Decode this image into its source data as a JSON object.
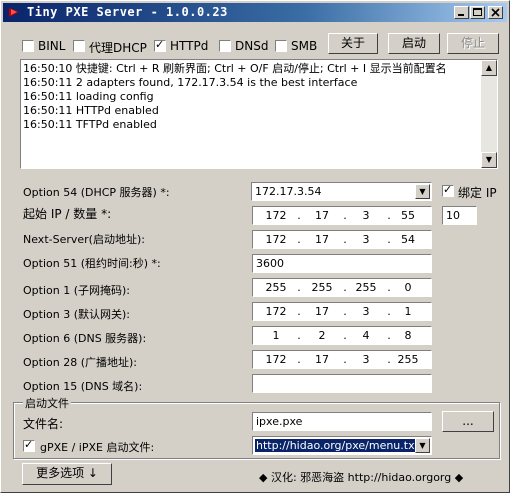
{
  "window": {
    "title": "Tiny PXE Server - 1.0.0.23"
  },
  "services": [
    {
      "label": "BINL",
      "checked": false
    },
    {
      "label": "代理DHCP",
      "checked": false
    },
    {
      "label": "HTTPd",
      "checked": true
    },
    {
      "label": "DNSd",
      "checked": false
    },
    {
      "label": "SMB",
      "checked": false
    }
  ],
  "buttons": {
    "close": "关于",
    "start": "启动",
    "stop": "停止",
    "browse": "...",
    "more_options": "更多选项 ↓"
  },
  "log": [
    "16:50:10 快捷键:  Ctrl + R 刷新界面;  Ctrl + O/F 启动/停止;  Ctrl + I 显示当前配置名",
    "16:50:11 2 adapters found, 172.17.3.54 is the best interface",
    "16:50:11 loading config",
    "16:50:11 HTTPd enabled",
    "16:50:11 TFTPd enabled"
  ],
  "form": {
    "option54_label": "Option 54 (DHCP 服务器) *:",
    "option54_value": "172.17.3.54",
    "bind_ip_label": "绑定 IP",
    "bind_ip_checked": true,
    "start_ip_label": "起始 IP / 数量 *:",
    "start_ip": [
      "172",
      "17",
      "3",
      "55"
    ],
    "count": "10",
    "next_server_label": "Next-Server(启动地址):",
    "next_server": [
      "172",
      "17",
      "3",
      "54"
    ],
    "option51_label": "Option 51 (租约时间:秒) *:",
    "option51_value": "3600",
    "option1_label": "Option 1 (子网掩码):",
    "option1": [
      "255",
      "255",
      "255",
      "0"
    ],
    "option3_label": "Option 3 (默认网关):",
    "option3": [
      "172",
      "17",
      "3",
      "1"
    ],
    "option6_label": "Option 6 (DNS 服务器):",
    "option6": [
      "1",
      "2",
      "4",
      "8"
    ],
    "option28_label": "Option 28 (广播地址):",
    "option28": [
      "172",
      "17",
      "3",
      "255"
    ],
    "option15_label": "Option 15 (DNS 域名):",
    "option15_value": ""
  },
  "boot": {
    "group_title": "启动文件",
    "filename_label": "文件名:",
    "filename": "ipxe.pxe",
    "gpxe_label": "gPXE / iPXE 启动文件:",
    "gpxe_checked": true,
    "gpxe_url": "http://hidao.org/pxe/menu.txt"
  },
  "footer": {
    "credit": "◆ 汉化: 邪恶海盗  http://hidao.org",
    "credit_tail": "org ◆"
  }
}
